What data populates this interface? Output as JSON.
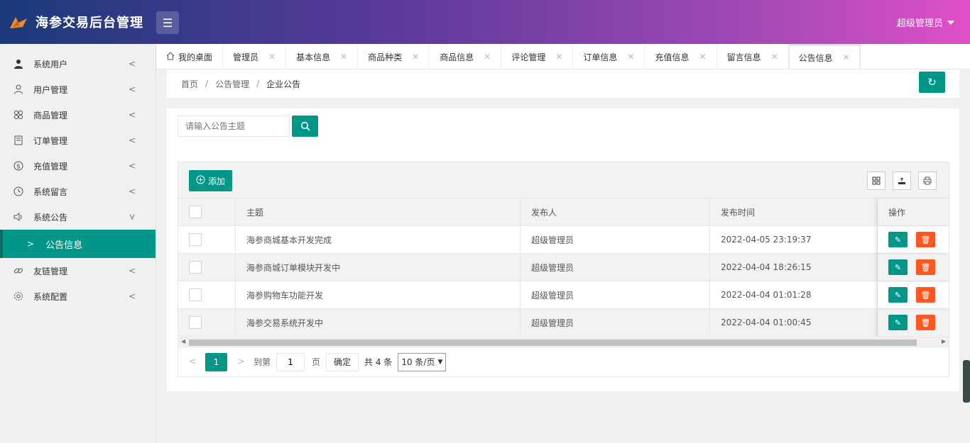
{
  "header": {
    "app_title": "海参交易后台管理",
    "user_label": "超级管理员"
  },
  "sidebar": {
    "items": [
      {
        "label": "系统用户",
        "icon": "user-filled-icon"
      },
      {
        "label": "用户管理",
        "icon": "user-outline-icon"
      },
      {
        "label": "商品管理",
        "icon": "grid-icon"
      },
      {
        "label": "订单管理",
        "icon": "doc-icon"
      },
      {
        "label": "充值管理",
        "icon": "dollar-icon"
      },
      {
        "label": "系统留言",
        "icon": "clock-icon"
      },
      {
        "label": "系统公告",
        "icon": "speaker-icon"
      }
    ],
    "sub_item": {
      "label": "公告信息"
    },
    "items_after": [
      {
        "label": "友链管理",
        "icon": "link-icon"
      },
      {
        "label": "系统配置",
        "icon": "gear-icon"
      }
    ]
  },
  "tabs": [
    {
      "label": "我的桌面",
      "closable": false
    },
    {
      "label": "管理员",
      "closable": true
    },
    {
      "label": "基本信息",
      "closable": true
    },
    {
      "label": "商品种类",
      "closable": true
    },
    {
      "label": "商品信息",
      "closable": true
    },
    {
      "label": "评论管理",
      "closable": true
    },
    {
      "label": "订单信息",
      "closable": true
    },
    {
      "label": "充值信息",
      "closable": true
    },
    {
      "label": "留言信息",
      "closable": true
    },
    {
      "label": "公告信息",
      "closable": true,
      "active": true
    }
  ],
  "breadcrumb": {
    "home": "首页",
    "level1": "公告管理",
    "level2": "企业公告",
    "separator": "/"
  },
  "search": {
    "placeholder": "请输入公告主题"
  },
  "toolbar": {
    "add_label": "添加"
  },
  "table": {
    "columns": [
      "主题",
      "发布人",
      "发布时间",
      "操作"
    ],
    "rows": [
      {
        "subject": "海参商城基本开发完成",
        "publisher": "超级管理员",
        "time": "2022-04-05 23:19:37"
      },
      {
        "subject": "海参商城订单模块开发中",
        "publisher": "超级管理员",
        "time": "2022-04-04 18:26:15"
      },
      {
        "subject": "海参购物车功能开发",
        "publisher": "超级管理员",
        "time": "2022-04-04 01:01:28"
      },
      {
        "subject": "海参交易系统开发中",
        "publisher": "超级管理员",
        "time": "2022-04-04 01:00:45"
      }
    ]
  },
  "pager": {
    "current": "1",
    "goto_label": "到第",
    "page_input": "1",
    "page_unit": "页",
    "confirm": "确定",
    "total": "共 4 条",
    "page_size": "10 条/页"
  },
  "colors": {
    "primary": "#009688",
    "danger": "#ff5722"
  }
}
